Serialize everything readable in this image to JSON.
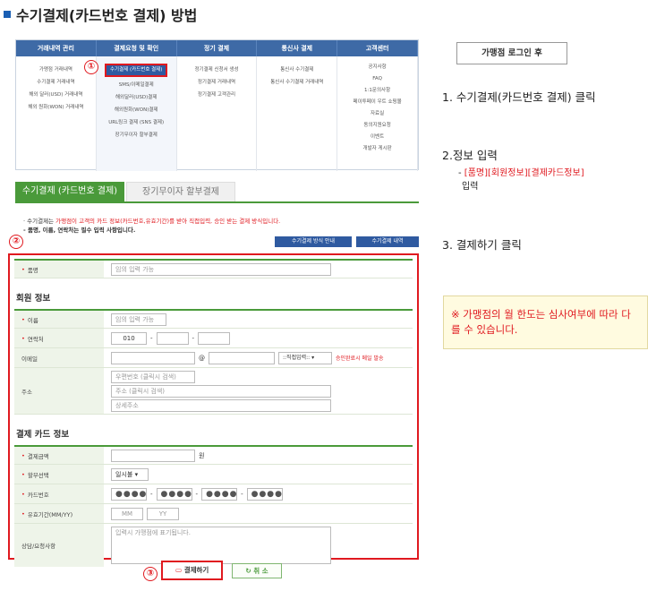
{
  "page_title": "수기결제(카드번호 결제) 방법",
  "nav": {
    "headers": [
      "거래내역 관리",
      "결제요청 및 확인",
      "정기 결제",
      "통신사 결제",
      "고객센터"
    ],
    "columns": [
      [
        "가맹점 거래내역",
        "수기결제 거래내역",
        "해외 달러(USD) 거래내역",
        "해외 원화(WON) 거래내역"
      ],
      [
        "수기결제 (카드번호 결제)",
        "SMS/이메일결제",
        "해외달러(USD)결제",
        "해외원화(WON)결제",
        "URL링크 결제 (SNS 결제)",
        "장기무이자 할부결제"
      ],
      [
        "정기결제 신청서 생성",
        "정기결제 거래내역",
        "정기결제 고객관리"
      ],
      [
        "통신사 수기결제",
        "통신사 수기결제 거래내역"
      ],
      [
        "공지사항",
        "FAQ",
        "1:1문의사항",
        "페이투페이 우트 쇼핑몰",
        "자료실",
        "동의지원요청",
        "이벤트",
        "개발자 게시판"
      ]
    ]
  },
  "markers": [
    "①",
    "②",
    "③"
  ],
  "tabs": [
    "수기결제 (카드번호 결제)",
    "장기무이자 할부결제"
  ],
  "notice": {
    "line1_prefix": "· 수기결제는 ",
    "line1_red": "가맹점이 고객의 카드 정보(카드번호,유효기간)를 받아 직접입력, 승인 받는 결제 방식입니다.",
    "line2": "- 품명, 이름, 연락처는 필수 입력 사항입니다."
  },
  "guide_buttons": [
    "수기결제 방식 안내",
    "수기결제 내역"
  ],
  "form": {
    "product_label": "품명",
    "product_placeholder": "임의 입력 가능",
    "member_section": "회원 정보",
    "name_label": "이름",
    "name_placeholder": "임의 입력 가능",
    "phone_label": "연락처",
    "phone_prefix": "010",
    "email_label": "이메일",
    "email_at": "@",
    "email_select": "::직접입력::",
    "email_note": "승인완료시 메일 발송",
    "address_label": "주소",
    "zip_placeholder": "우편번호 (클릭시 검색)",
    "addr_placeholder": "주소 (클릭시 검색)",
    "detail_placeholder": "상세주소",
    "card_section": "결제 카드 정보",
    "amount_label": "결제금액",
    "amount_unit": "원",
    "installment_label": "할부선택",
    "installment_value": "일시불",
    "cardno_label": "카드번호",
    "card_mask": "●●●●",
    "expiry_label": "유효기간(MM/YY)",
    "mm_placeholder": "MM",
    "yy_placeholder": "YY",
    "memo_label": "상담/요청사항",
    "memo_placeholder": "입력시 가맹점에 표기됩니다."
  },
  "bottom": {
    "pay": "결제하기",
    "cancel": "취 소"
  },
  "right": {
    "login": "가맹점 로그인 후",
    "step1": "1. 수기결제(카드번호 결제) 클릭",
    "step2": "2.정보 입력",
    "step2_sub_red": "[품명][회원정보][결제카드정보]",
    "step2_sub2": "입력",
    "step3": "3. 결제하기 클릭",
    "note": "※ 가맹점의 월 한도는 심사여부에 따라 다를 수 있습니다."
  }
}
